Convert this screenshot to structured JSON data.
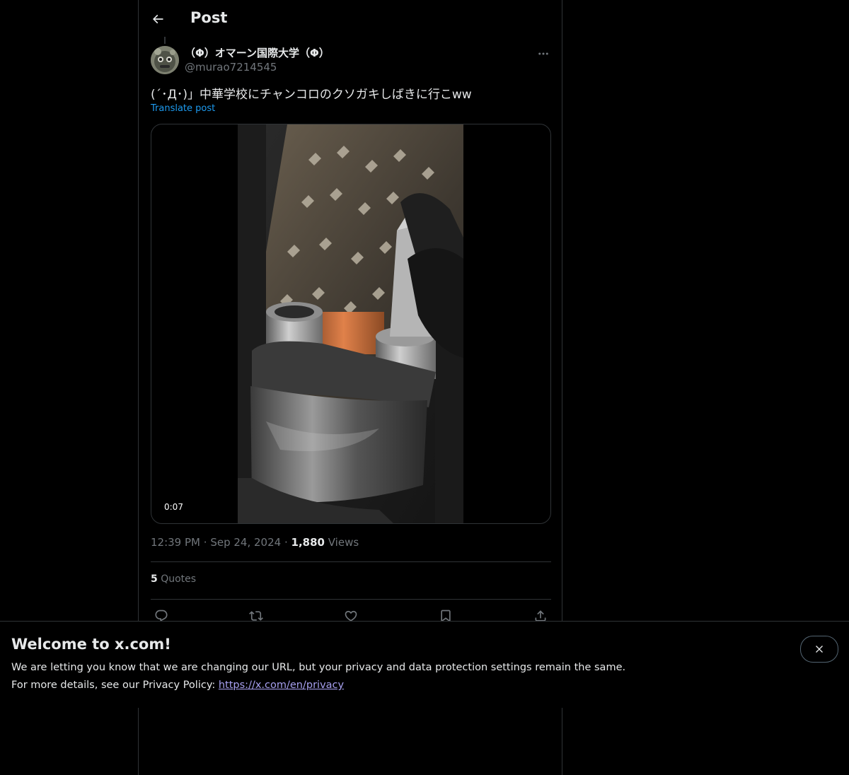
{
  "header": {
    "title": "Post"
  },
  "post": {
    "display_name": "（Φ）オマーン国際大学（Φ）",
    "handle": "@murao7214545",
    "text": "(´･Д･)」中華学校にチャンコロのクソガキしばきに行こww",
    "translate_label": "Translate post",
    "video_duration": "0:07",
    "time": "12:39 PM",
    "date": "Sep 24, 2024",
    "separator": "·",
    "views_count": "1,880",
    "views_label": "Views",
    "quotes_count": "5",
    "quotes_label": "Quotes"
  },
  "actions": [
    "reply-icon",
    "repost-icon",
    "like-icon",
    "bookmark-icon",
    "share-icon"
  ],
  "banner": {
    "title": "Welcome to x.com!",
    "line1": "We are letting you know that we are changing our URL, but your privacy and data protection settings remain the same.",
    "line2_prefix": "For more details, see our Privacy Policy: ",
    "link": "https://x.com/en/privacy"
  },
  "colors": {
    "background": "#000000",
    "text": "#e7e9ea",
    "secondary": "#71767b",
    "link": "#1d9bf0",
    "border": "#2f3336"
  }
}
